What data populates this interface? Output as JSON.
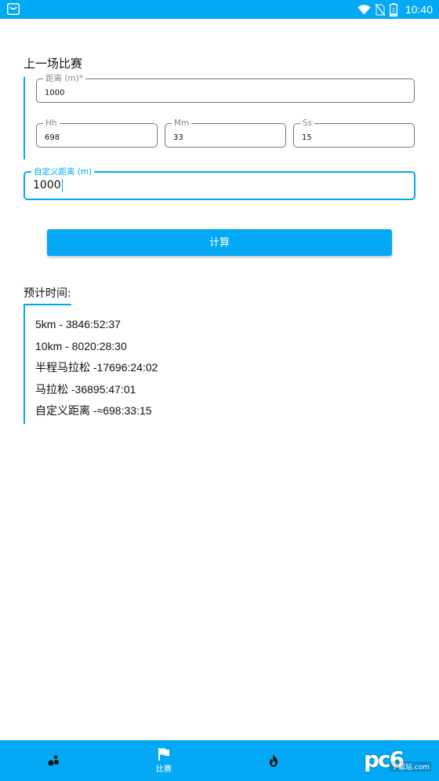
{
  "status_bar": {
    "time": "10:40",
    "battery_level": "2",
    "icons": [
      "store-icon",
      "wifi-icon",
      "no-sim-icon",
      "battery-icon"
    ]
  },
  "colors": {
    "accent": "#03a9f4",
    "text": "#111111",
    "border": "#777777",
    "label": "#888888"
  },
  "previous_race": {
    "title": "上一场比赛",
    "distance": {
      "label": "距离 (m)*",
      "value": "1000"
    },
    "hours": {
      "label": "Hh",
      "value": "698"
    },
    "minutes": {
      "label": "Mm",
      "value": "33"
    },
    "seconds": {
      "label": "Ss",
      "value": "15"
    }
  },
  "custom_distance": {
    "label": "自定义距离 (m)",
    "value": "1000"
  },
  "calculate_button": {
    "label": "计算"
  },
  "results": {
    "title": "预计时间:",
    "rows": [
      "5km - 3846:52:37",
      "10km - 8020:28:30",
      "半程马拉松 -17696:24:02",
      "马拉松 -36895:47:01",
      "自定义距离 -≈698:33:15"
    ]
  },
  "bottom_nav": {
    "items": [
      {
        "icon": "dots-icon",
        "label": ""
      },
      {
        "icon": "flag-icon",
        "label": "比赛"
      },
      {
        "icon": "flame-icon",
        "label": ""
      }
    ]
  },
  "watermark": {
    "mark": "pc6",
    "site": "下载站",
    "domain": ".com"
  }
}
